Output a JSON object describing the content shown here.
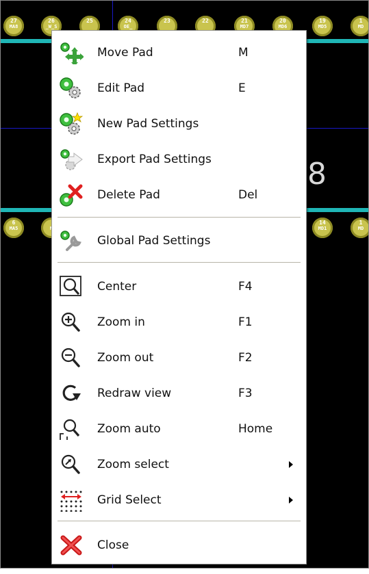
{
  "board": {
    "pads_top": [
      {
        "num": "27",
        "net": "MA8"
      },
      {
        "num": "26",
        "net": "_W_S"
      },
      {
        "num": "25",
        "net": ""
      },
      {
        "num": "24",
        "net": "OE_"
      },
      {
        "num": "23",
        "net": ""
      },
      {
        "num": "22",
        "net": ""
      },
      {
        "num": "21",
        "net": "MD7"
      },
      {
        "num": "20",
        "net": "MD6"
      },
      {
        "num": "19",
        "net": "MD5"
      },
      {
        "num": "1",
        "net": "MD"
      }
    ],
    "pads_bottom": [
      {
        "num": "6",
        "net": "MA5"
      },
      {
        "num": "",
        "net": "N"
      },
      {
        "num": "14",
        "net": "MD1"
      },
      {
        "num": "1",
        "net": "MD"
      }
    ],
    "big_label": "8"
  },
  "menu": {
    "group1": [
      {
        "label": "Move Pad",
        "shortcut": "M",
        "icon": "move-pad-icon"
      },
      {
        "label": "Edit Pad",
        "shortcut": "E",
        "icon": "edit-pad-icon"
      },
      {
        "label": "New Pad Settings",
        "shortcut": "",
        "icon": "new-pad-settings-icon"
      },
      {
        "label": "Export Pad Settings",
        "shortcut": "",
        "icon": "export-pad-settings-icon"
      },
      {
        "label": "Delete Pad",
        "shortcut": "Del",
        "icon": "delete-pad-icon"
      }
    ],
    "group2": [
      {
        "label": "Global Pad Settings",
        "shortcut": "",
        "icon": "global-pad-settings-icon"
      }
    ],
    "group3": [
      {
        "label": "Center",
        "shortcut": "F4",
        "icon": "center-icon"
      },
      {
        "label": "Zoom in",
        "shortcut": "F1",
        "icon": "zoom-in-icon"
      },
      {
        "label": "Zoom out",
        "shortcut": "F2",
        "icon": "zoom-out-icon"
      },
      {
        "label": "Redraw view",
        "shortcut": "F3",
        "icon": "redraw-icon"
      },
      {
        "label": "Zoom auto",
        "shortcut": "Home",
        "icon": "zoom-auto-icon"
      },
      {
        "label": "Zoom select",
        "shortcut": "",
        "icon": "zoom-select-icon",
        "submenu": true
      },
      {
        "label": "Grid Select",
        "shortcut": "",
        "icon": "grid-select-icon",
        "submenu": true
      }
    ],
    "group4": [
      {
        "label": "Close",
        "shortcut": "",
        "icon": "close-icon"
      }
    ]
  }
}
